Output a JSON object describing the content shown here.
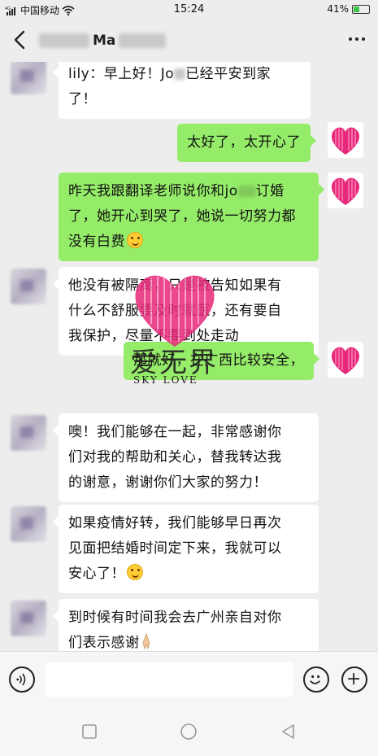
{
  "status_bar": {
    "carrier": "中国移动",
    "network": "4G",
    "time": "15:24",
    "battery_percent": "41%",
    "battery_level": 0.41
  },
  "header": {
    "title_visible": "Ma",
    "more_icon": "ellipsis-icon",
    "back_icon": "chevron-left-icon"
  },
  "messages": [
    {
      "side": "left",
      "lines": [
        "lily：早上好！Jo",
        "已经平安到家",
        "了！"
      ]
    },
    {
      "side": "right",
      "lines": [
        "太好了，太开心了"
      ]
    },
    {
      "side": "right",
      "lines": [
        "昨天我跟翻译老师说你和jo",
        "订婚",
        "了，她开心到哭了，她说一切努力都",
        "没有白费"
      ]
    },
    {
      "side": "left",
      "lines": [
        "他没有被隔离，只是被告知如果有",
        "什么不舒服要及时就医，还有要自",
        "我保护，尽量不要到处走动"
      ]
    },
    {
      "side": "right",
      "lines": [
        "那就好，在广西比较安全，"
      ]
    },
    {
      "side": "left",
      "lines": [
        "噢！我们能够在一起，非常感谢你",
        "们对我的帮助和关心，替我转达我",
        "的谢意，谢谢你们大家的努力！"
      ]
    },
    {
      "side": "left",
      "lines": [
        "如果疫情好转，我们能够早日再次",
        "见面把结婚时间定下来，我就可以",
        "安心了！"
      ]
    },
    {
      "side": "left",
      "lines": [
        "到时候有时间我会去广州亲自对你",
        "们表示感谢"
      ]
    }
  ],
  "watermark": {
    "text": "爱无界",
    "subtext": "SKY LOVE"
  },
  "input_bar": {
    "placeholder": "",
    "voice_icon": "voice-icon",
    "emoji_icon": "emoji-icon",
    "plus_icon": "plus-icon"
  },
  "colors": {
    "background": "#ededed",
    "bubble_self": "#95ec69",
    "bubble_other": "#ffffff",
    "heart": "#e8287a"
  }
}
